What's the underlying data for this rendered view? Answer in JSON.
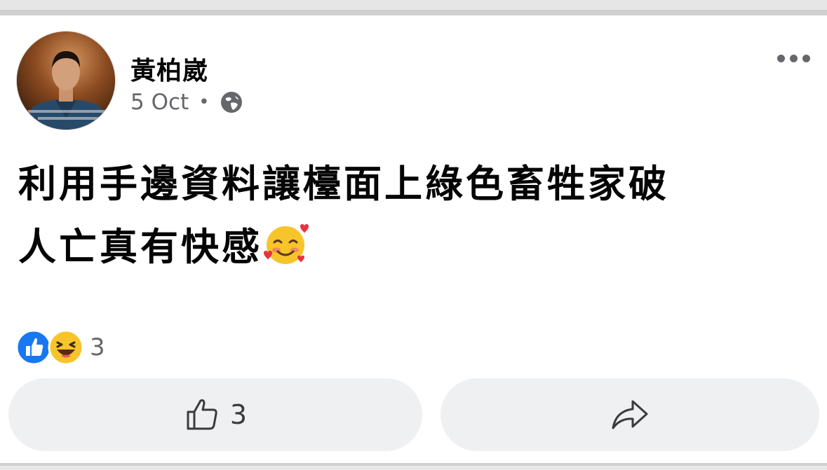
{
  "post": {
    "author": "黃柏崴",
    "date": "5 Oct",
    "separator": "•",
    "privacy_icon": "globe-icon",
    "text_line1": "利用手邊資料讓檯面上綠色畜牲家破",
    "text_line2": "人亡真有快感",
    "emoji": "smiling-face-with-hearts-emoji"
  },
  "reactions": {
    "icons": [
      "like-icon",
      "haha-icon"
    ],
    "count": "3"
  },
  "actions": {
    "like_icon": "thumbs-up-icon",
    "like_count": "3",
    "share_icon": "share-icon"
  },
  "colors": {
    "like_blue": "#1877f2",
    "haha_yellow": "#f7c42b",
    "secondary_text": "#65676b",
    "button_bg": "#eff0f2"
  }
}
